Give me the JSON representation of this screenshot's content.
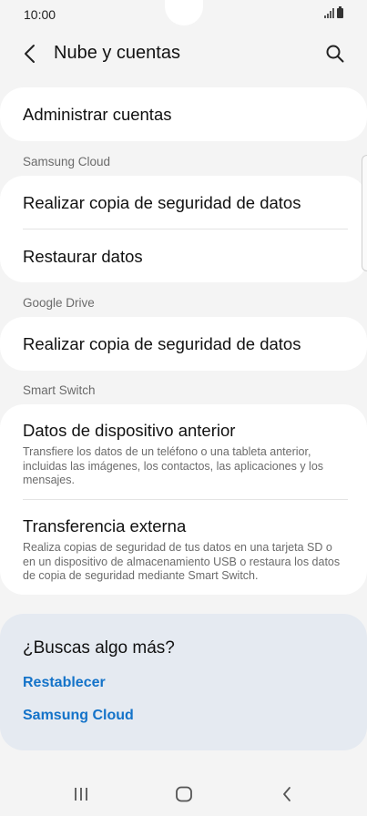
{
  "status_bar": {
    "time": "10:00"
  },
  "header": {
    "title": "Nube y cuentas"
  },
  "items": {
    "manage_accounts": "Administrar cuentas",
    "samsung_cloud_label": "Samsung Cloud",
    "samsung_backup": "Realizar copia de seguridad de datos",
    "samsung_restore": "Restaurar datos",
    "google_drive_label": "Google Drive",
    "google_backup": "Realizar copia de seguridad de datos",
    "smart_switch_label": "Smart Switch",
    "previous_device": {
      "title": "Datos de dispositivo anterior",
      "desc": "Transfiere los datos de un teléfono o una tableta anterior, incluidas las imágenes, los contactos, las aplicaciones y los mensajes."
    },
    "external_transfer": {
      "title": "Transferencia externa",
      "desc": "Realiza copias de seguridad de tus datos en una tarjeta SD o en un dispositivo de almacenamiento USB o restaura los datos de copia de seguridad mediante Smart Switch."
    }
  },
  "more": {
    "title": "¿Buscas algo más?",
    "links": [
      "Restablecer",
      "Samsung Cloud"
    ]
  },
  "colors": {
    "background": "#f4f4f4",
    "card": "#ffffff",
    "suggestion_card": "#e5eaf1",
    "link": "#1473c9"
  }
}
